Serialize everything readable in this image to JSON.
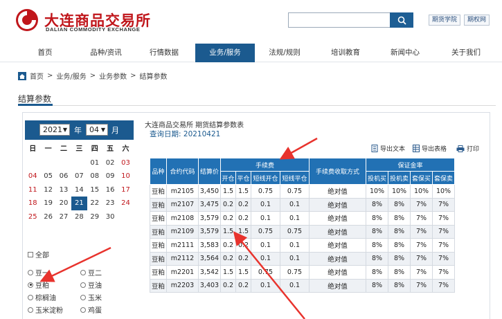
{
  "header": {
    "logo_cn": "大连商品交易所",
    "logo_en": "DALIAN COMMODITY EXCHANGE",
    "search_placeholder": "",
    "links": [
      "期货学院",
      "期权网"
    ]
  },
  "nav": {
    "items": [
      "首页",
      "品种/资讯",
      "行情数据",
      "业务/服务",
      "法规/规则",
      "培训教育",
      "新闻中心",
      "关于我们"
    ],
    "active_index": 3
  },
  "breadcrumb": {
    "home": "首页",
    "items": [
      "业务/服务",
      "业务参数",
      "结算参数"
    ],
    "sep": ">"
  },
  "page_title": "结算参数",
  "calendar": {
    "year": "2021",
    "year_label": "年",
    "month": "04",
    "month_label": "月",
    "weekdays": [
      "日",
      "一",
      "二",
      "三",
      "四",
      "五",
      "六"
    ],
    "weeks": [
      [
        "",
        "",
        "",
        "",
        "01",
        "02",
        "03"
      ],
      [
        "04",
        "05",
        "06",
        "07",
        "08",
        "09",
        "10"
      ],
      [
        "11",
        "12",
        "13",
        "14",
        "15",
        "16",
        "17"
      ],
      [
        "18",
        "19",
        "20",
        "21",
        "22",
        "23",
        "24"
      ],
      [
        "25",
        "26",
        "27",
        "28",
        "29",
        "30",
        ""
      ]
    ],
    "selected": "21"
  },
  "filters": {
    "all_label": "全部",
    "options": [
      {
        "label": "豆一",
        "checked": false
      },
      {
        "label": "豆二",
        "checked": false
      },
      {
        "label": "豆粕",
        "checked": true
      },
      {
        "label": "豆油",
        "checked": false
      },
      {
        "label": "棕榈油",
        "checked": false
      },
      {
        "label": "玉米",
        "checked": false
      },
      {
        "label": "玉米淀粉",
        "checked": false
      },
      {
        "label": "鸡蛋",
        "checked": false
      }
    ]
  },
  "table_info": {
    "title": "大连商品交易所 期货结算参数表",
    "date_label": "查询日期:",
    "date_value": "20210421"
  },
  "tools": {
    "export_text": "导出文本",
    "export_table": "导出表格",
    "print": "打印"
  },
  "table": {
    "headers": {
      "variety": "品种",
      "contract": "合约代码",
      "settle": "结算价",
      "fee_group": "手续费",
      "fee_cols": [
        "开仓",
        "平仓",
        "短线开仓",
        "短线平仓"
      ],
      "fee_method": "手续费收取方式",
      "margin_group": "保证金率",
      "margin_cols": [
        "投机买",
        "投机卖",
        "套保买",
        "套保卖"
      ]
    },
    "rows": [
      [
        "豆粕",
        "m2105",
        "3,450",
        "1.5",
        "1.5",
        "0.75",
        "0.75",
        "绝对值",
        "10%",
        "10%",
        "10%",
        "10%"
      ],
      [
        "豆粕",
        "m2107",
        "3,475",
        "0.2",
        "0.2",
        "0.1",
        "0.1",
        "绝对值",
        "8%",
        "8%",
        "7%",
        "7%"
      ],
      [
        "豆粕",
        "m2108",
        "3,579",
        "0.2",
        "0.2",
        "0.1",
        "0.1",
        "绝对值",
        "8%",
        "8%",
        "7%",
        "7%"
      ],
      [
        "豆粕",
        "m2109",
        "3,579",
        "1.5",
        "1.5",
        "0.75",
        "0.75",
        "绝对值",
        "8%",
        "8%",
        "7%",
        "7%"
      ],
      [
        "豆粕",
        "m2111",
        "3,583",
        "0.2",
        "0.2",
        "0.1",
        "0.1",
        "绝对值",
        "8%",
        "8%",
        "7%",
        "7%"
      ],
      [
        "豆粕",
        "m2112",
        "3,564",
        "0.2",
        "0.2",
        "0.1",
        "0.1",
        "绝对值",
        "8%",
        "8%",
        "7%",
        "7%"
      ],
      [
        "豆粕",
        "m2201",
        "3,542",
        "1.5",
        "1.5",
        "0.75",
        "0.75",
        "绝对值",
        "8%",
        "8%",
        "7%",
        "7%"
      ],
      [
        "豆粕",
        "m2203",
        "3,403",
        "0.2",
        "0.2",
        "0.1",
        "0.1",
        "绝对值",
        "8%",
        "8%",
        "7%",
        "7%"
      ]
    ]
  },
  "colors": {
    "brand_red": "#c0161b",
    "nav_active": "#1b5a8f",
    "table_header": "#2271b4",
    "annotation_arrow": "#e8332d"
  }
}
